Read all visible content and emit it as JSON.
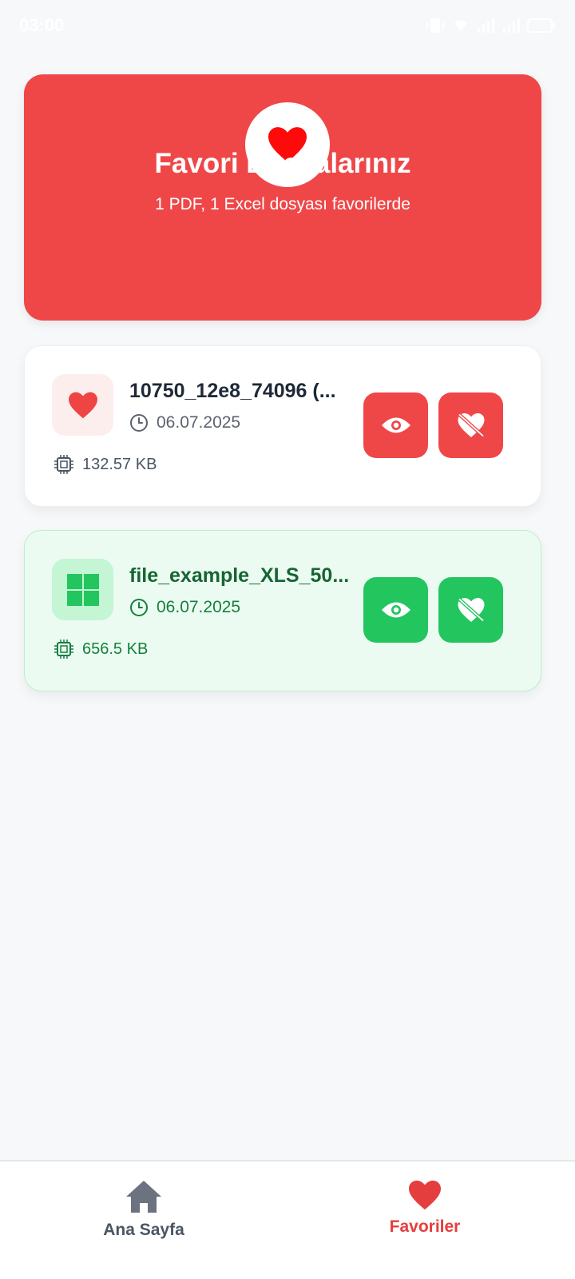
{
  "status_bar": {
    "time": "03:00",
    "battery": "25"
  },
  "hero": {
    "icon": "heart-icon",
    "title": "Favori Dosyalarınız",
    "subtitle": "1 PDF, 1 Excel dosyası favorilerde"
  },
  "files": [
    {
      "type": "pdf",
      "icon": "heart-icon",
      "name": "10750_12e8_74096 (...",
      "date": "06.07.2025",
      "size": "132.57 KB",
      "accent": "#ef4748"
    },
    {
      "type": "excel",
      "icon": "windows-grid-icon",
      "name": "file_example_XLS_50...",
      "date": "06.07.2025",
      "size": "656.5 KB",
      "accent": "#22c55e"
    }
  ],
  "bottom_nav": {
    "items": [
      {
        "label": "Ana Sayfa",
        "icon": "home-icon",
        "active": false
      },
      {
        "label": "Favoriler",
        "icon": "heart-icon",
        "active": true
      }
    ]
  },
  "colors": {
    "primary": "#ef4748",
    "excel": "#22c55e",
    "background": "#f7f8fa"
  }
}
